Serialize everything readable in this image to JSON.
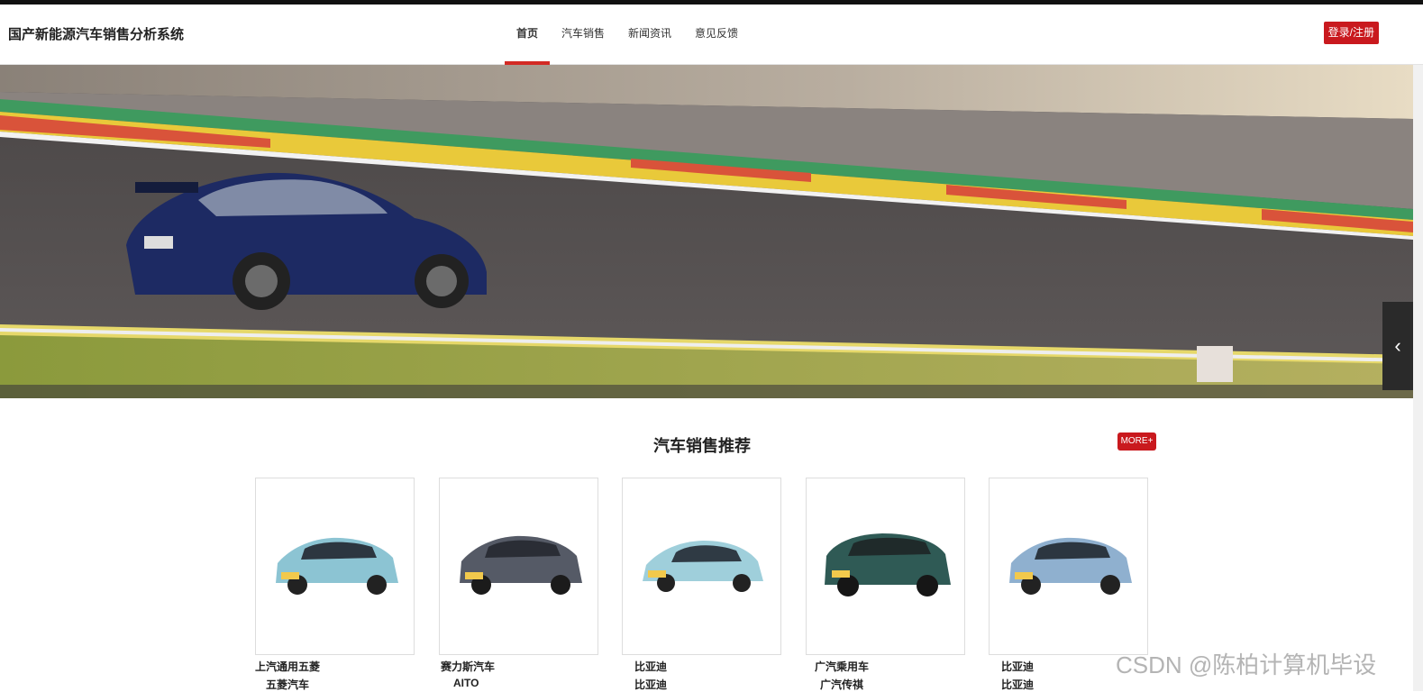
{
  "site": {
    "title": "国产新能源汽车销售分析系统"
  },
  "nav": {
    "items": [
      {
        "label": "首页",
        "active": true
      },
      {
        "label": "汽车销售",
        "active": false
      },
      {
        "label": "新闻资讯",
        "active": false
      },
      {
        "label": "意见反馈",
        "active": false
      }
    ],
    "login_label": "登录/注册"
  },
  "banner": {
    "slide_count": 3,
    "active_slide": 1,
    "prev_icon": "chevron-left-icon"
  },
  "section": {
    "title": "汽车销售推荐",
    "more_label": "MORE+"
  },
  "cars": [
    {
      "brand": "上汽通用五菱",
      "series": "五菱汽车",
      "color": "#8cc4d3"
    },
    {
      "brand": "赛力斯汽车",
      "series": "AITO",
      "color": "#555a66"
    },
    {
      "brand": "比亚迪",
      "series": "比亚迪",
      "color": "#9fcfdb"
    },
    {
      "brand": "广汽乘用车",
      "series": "广汽传祺",
      "color": "#2f5a55"
    },
    {
      "brand": "比亚迪",
      "series": "比亚迪",
      "color": "#8fb0cf"
    }
  ],
  "watermark": "CSDN @陈柏计算机毕设",
  "colors": {
    "accent": "#c9191e",
    "active_underline": "#d32a24",
    "dot_active": "#d93a2b"
  }
}
